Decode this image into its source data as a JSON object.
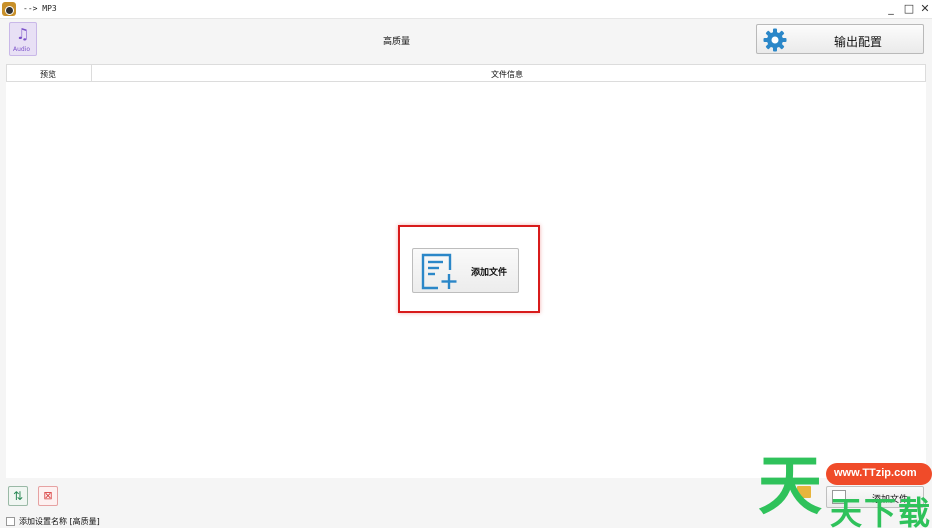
{
  "titlebar": {
    "title": "--> MP3",
    "icon": "app-logo-icon",
    "minimize": "_",
    "maximize": "□",
    "close": "✕"
  },
  "header": {
    "format_icon": "audio-file-icon",
    "format_icon_label": "Audio",
    "preset_name": "高质量",
    "output_config_label": "输出配置",
    "output_config_icon": "gear-icon"
  },
  "columns": {
    "preview": "预览",
    "file_info": "文件信息"
  },
  "center": {
    "add_file_label": "添加文件",
    "add_file_icon": "add-document-icon",
    "highlight_color": "#d81b1b"
  },
  "bottom": {
    "sort_icon": "sort-icon",
    "remove_icon": "remove-icon",
    "checkbox_label": "添加设置名称 [高质量]",
    "add_file_label": "添加文件"
  },
  "watermark": {
    "url": "www.TTzip.com",
    "big_char": "天",
    "small_chars": "天下载"
  },
  "colors": {
    "accent": "#2b87c8",
    "watermark_green": "#2fc25b",
    "watermark_orange": "#f04b29"
  }
}
